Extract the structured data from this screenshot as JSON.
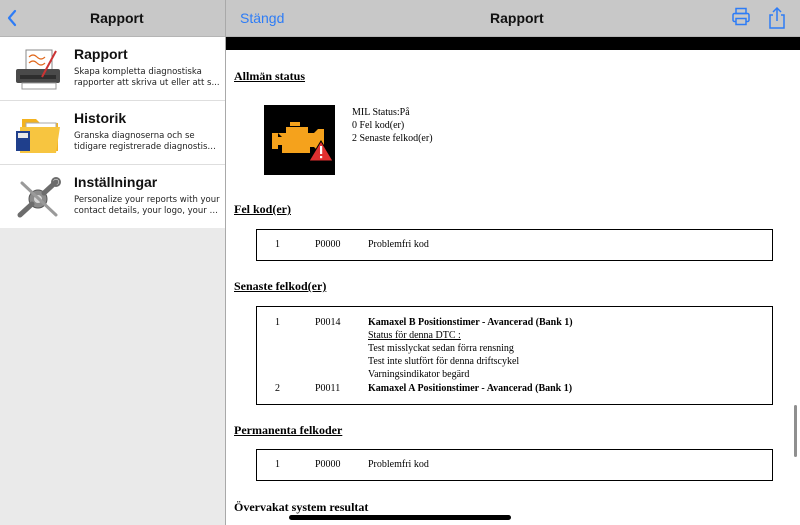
{
  "sidebar": {
    "title": "Rapport",
    "items": [
      {
        "title": "Rapport",
        "desc1": "Skapa kompletta diagnostiska",
        "desc2": "rapporter att skriva ut eller att s..."
      },
      {
        "title": "Historik",
        "desc1": "Granska diagnoserna och se",
        "desc2": "tidigare registrerade diagnostisk..."
      },
      {
        "title": "Inställningar",
        "desc1": "Personalize your reports with your",
        "desc2": "contact details, your logo, your c..."
      }
    ]
  },
  "header": {
    "close_label": "Stängd",
    "title": "Rapport",
    "icons": [
      "print-icon",
      "share-icon"
    ]
  },
  "report": {
    "general_status": {
      "heading": "Allmän status",
      "mil_status": "MIL Status:På",
      "fault_count": "0 Fel kod(er)",
      "recent_count": "2 Senaste felkod(er)"
    },
    "fault_codes": {
      "heading": "Fel kod(er)",
      "rows": [
        {
          "num": "1",
          "code": "P0000",
          "text": "Problemfri kod"
        }
      ]
    },
    "recent_codes": {
      "heading": "Senaste felkod(er)",
      "rows": [
        {
          "num": "1",
          "code": "P0014",
          "text": "Kamaxel B Positionstimer - Avancerad (Bank 1)",
          "status_label": "Status för denna DTC :",
          "status_lines": [
            "Test misslyckat sedan förra rensning",
            "Test inte slutfört för denna driftscykel",
            "Varningsindikator begärd"
          ]
        },
        {
          "num": "2",
          "code": "P0011",
          "text": "Kamaxel A Positionstimer - Avancerad (Bank 1)"
        }
      ]
    },
    "permanent_codes": {
      "heading": "Permanenta felkoder",
      "rows": [
        {
          "num": "1",
          "code": "P0000",
          "text": "Problemfri kod"
        }
      ]
    },
    "monitor_heading": "Övervakat system resultat"
  },
  "colors": {
    "accent": "#2d7cf6",
    "engine": "#f5a21c",
    "warning": "#e03030"
  }
}
